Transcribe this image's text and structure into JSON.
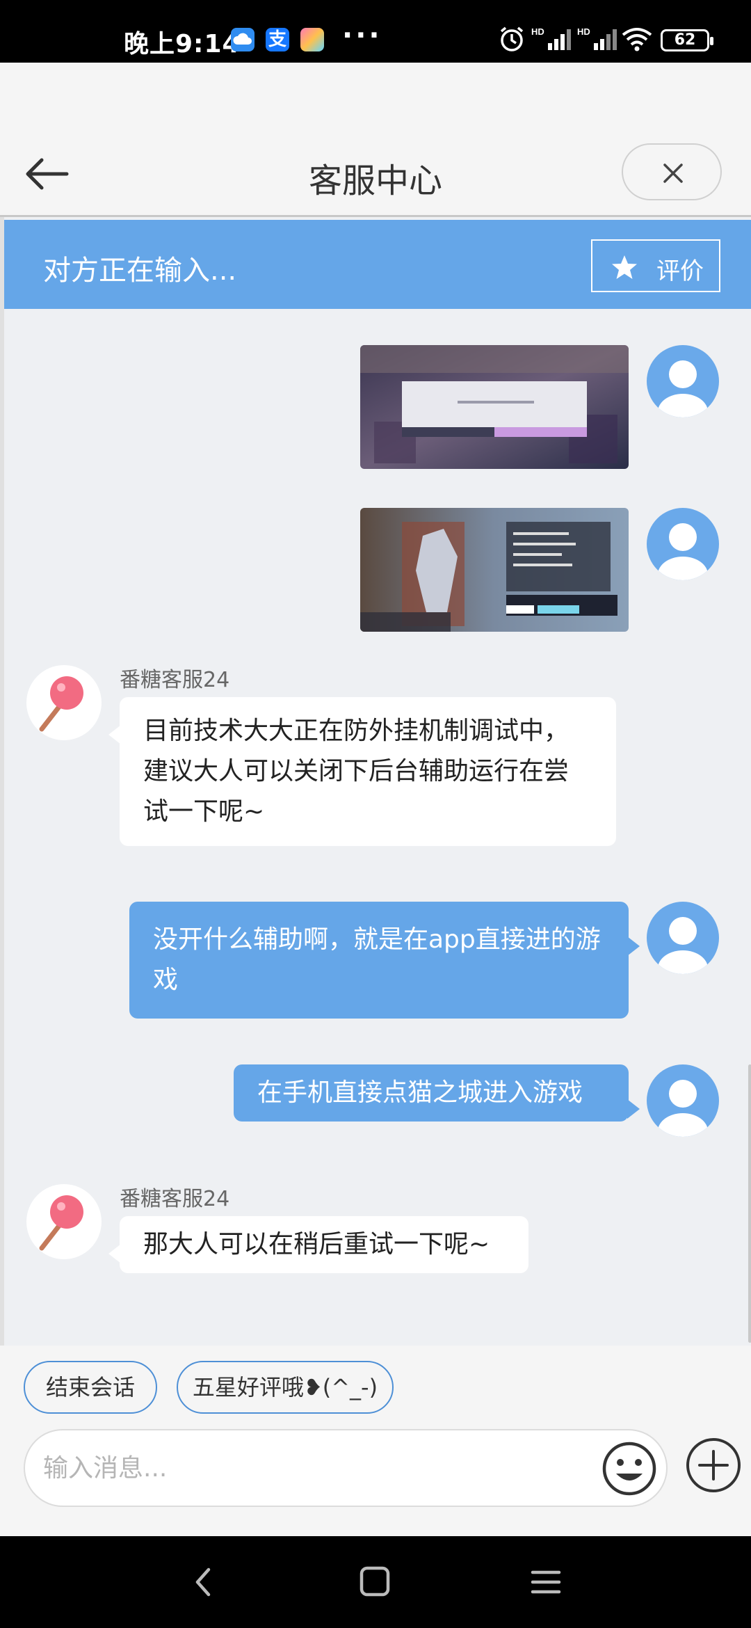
{
  "status_bar": {
    "time": "晚上9:14",
    "more": "···",
    "battery": "62",
    "app_icons": [
      "cloud-app-icon",
      "alipay-icon",
      "game-app-icon"
    ],
    "hd_labels": [
      "HD",
      "HD"
    ]
  },
  "header": {
    "title": "客服中心"
  },
  "typing_bar": {
    "status": "对方正在输入...",
    "rate_label": "评价"
  },
  "messages": {
    "agent_name_1": "番糖客服24",
    "agent_msg_1": "目前技术大大正在防外挂机制调试中，建议大人可以关闭下后台辅助运行在尝试一下呢~",
    "user_msg_1": "没开什么辅助啊，就是在app直接进的游戏",
    "user_msg_2": "在手机直接点猫之城进入游戏",
    "agent_name_2": "番糖客服24",
    "agent_msg_2": "那大人可以在稍后重试一下呢~"
  },
  "quick_replies": {
    "end_chat": "结束会话",
    "five_star": "五星好评哦❥(^_-)"
  },
  "input": {
    "placeholder": "输入消息..."
  },
  "colors": {
    "accent": "#65a6e8",
    "chip_border": "#4d8fd6",
    "background": "#eef0f3"
  }
}
